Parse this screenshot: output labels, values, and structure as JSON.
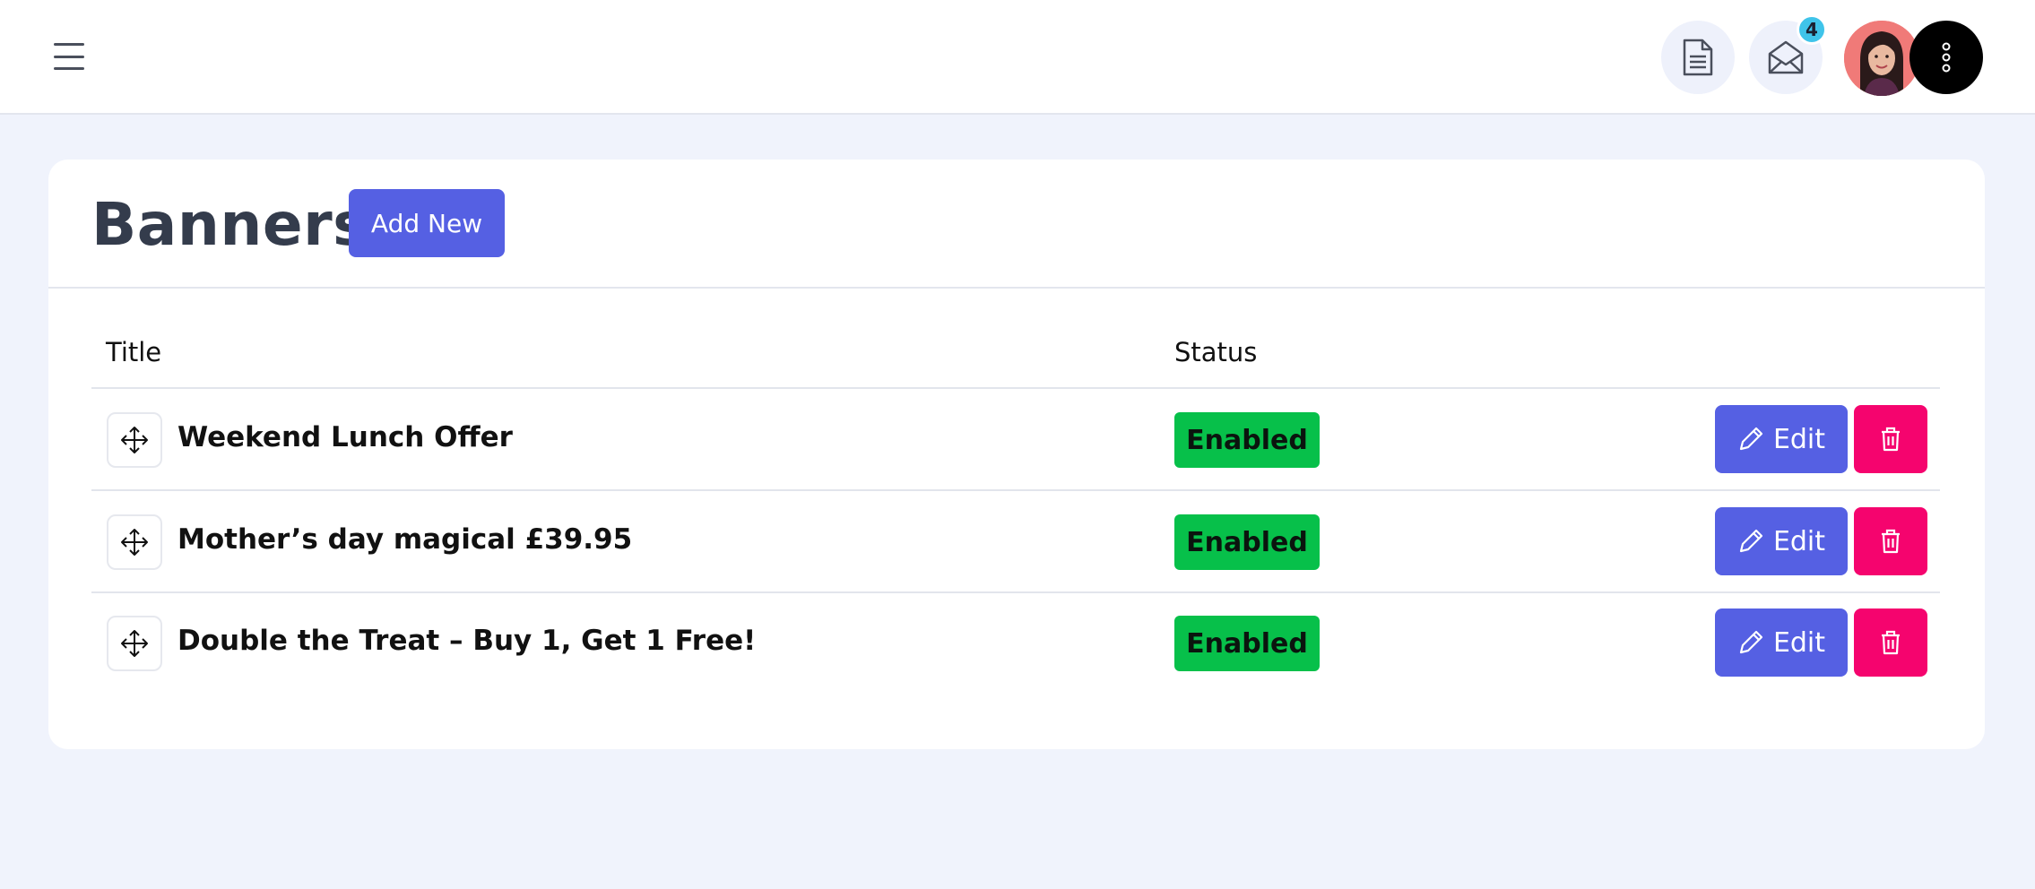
{
  "header": {
    "menu_icon": "hamburger-menu-icon",
    "document_icon": "document-icon",
    "mail_icon": "mail-open-icon",
    "notification_count": "4",
    "more_icon": "more-vertical-icon"
  },
  "page": {
    "title": "Banners",
    "add_new_label": "Add New"
  },
  "table": {
    "columns": [
      "Title",
      "Status"
    ],
    "rows": [
      {
        "title": "Weekend Lunch Offer",
        "status": "Enabled",
        "edit_label": "Edit"
      },
      {
        "title": "Mother’s day magical £39.95",
        "status": "Enabled",
        "edit_label": "Edit"
      },
      {
        "title": "Double the Treat – Buy 1, Get 1 Free!",
        "status": "Enabled",
        "edit_label": "Edit"
      }
    ]
  },
  "colors": {
    "primary": "#5560e3",
    "enabled": "#07c04a",
    "danger": "#f5046e",
    "background": "#f0f3fc",
    "badge": "#3fc4ea"
  }
}
